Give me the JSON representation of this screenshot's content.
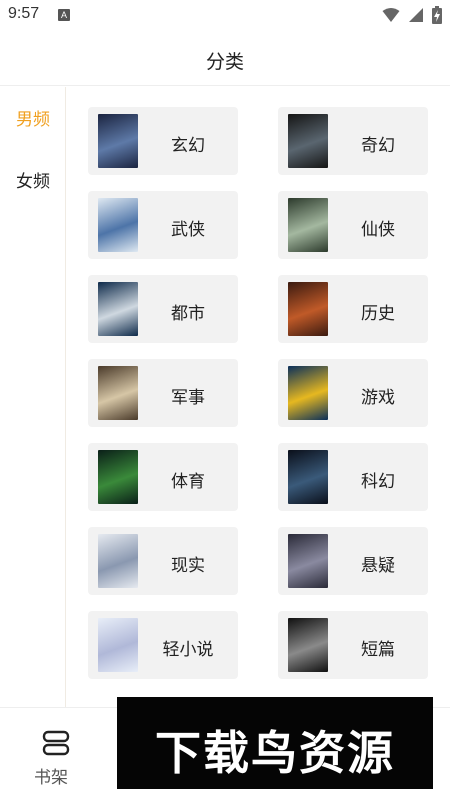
{
  "status_bar": {
    "time": "9:57",
    "badge": "A"
  },
  "header": {
    "title": "分类"
  },
  "sidebar": {
    "items": [
      {
        "label": "男频",
        "active": true
      },
      {
        "label": "女频",
        "active": false
      }
    ]
  },
  "categories": [
    {
      "label": "玄幻",
      "cover_text": "",
      "cover_colors": [
        "#1b2440",
        "#5e7aa8"
      ]
    },
    {
      "label": "奇幻",
      "cover_text": "",
      "cover_colors": [
        "#151515",
        "#5a6670"
      ]
    },
    {
      "label": "武侠",
      "cover_text": "",
      "cover_colors": [
        "#dfe9f2",
        "#4d74a8"
      ]
    },
    {
      "label": "仙侠",
      "cover_text": "",
      "cover_colors": [
        "#2c3a2c",
        "#a4b8a0"
      ]
    },
    {
      "label": "都市",
      "cover_text": "",
      "cover_colors": [
        "#0e2a4a",
        "#cfd8e0"
      ]
    },
    {
      "label": "历史",
      "cover_text": "",
      "cover_colors": [
        "#3a1a10",
        "#c05a28"
      ]
    },
    {
      "label": "军事",
      "cover_text": "",
      "cover_colors": [
        "#4a3a2a",
        "#d6c6a6"
      ]
    },
    {
      "label": "游戏",
      "cover_text": "",
      "cover_colors": [
        "#0a2f5a",
        "#e6b820"
      ]
    },
    {
      "label": "体育",
      "cover_text": "",
      "cover_colors": [
        "#0a1f18",
        "#3a8a3a"
      ]
    },
    {
      "label": "科幻",
      "cover_text": "",
      "cover_colors": [
        "#0a0f1a",
        "#3a5a7a"
      ]
    },
    {
      "label": "现实",
      "cover_text": "",
      "cover_colors": [
        "#e6eaf0",
        "#8a98b0"
      ]
    },
    {
      "label": "悬疑",
      "cover_text": "",
      "cover_colors": [
        "#2a2a38",
        "#8a8aa0"
      ]
    },
    {
      "label": "轻小说",
      "cover_text": "",
      "cover_colors": [
        "#e8eef8",
        "#b0b8d8"
      ]
    },
    {
      "label": "短篇",
      "cover_text": "",
      "cover_colors": [
        "#101010",
        "#8a8a8a"
      ]
    }
  ],
  "bottom_nav": {
    "shelf_label": "书架",
    "icon": "bookshelf-icon"
  },
  "watermark": {
    "text": "下载鸟资源"
  },
  "colors": {
    "accent": "#f0a020",
    "cell_bg": "#f2f2f2",
    "text": "#222222"
  }
}
